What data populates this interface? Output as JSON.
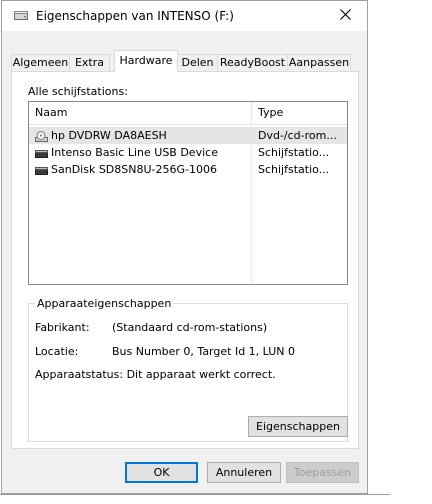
{
  "window": {
    "title": "Eigenschappen van INTENSO (F:)",
    "close_label": "Sluiten"
  },
  "tabs": [
    {
      "label": "Algemeen"
    },
    {
      "label": "Extra"
    },
    {
      "label": "Hardware",
      "active": true
    },
    {
      "label": "Delen"
    },
    {
      "label": "ReadyBoost"
    },
    {
      "label": "Aanpassen"
    }
  ],
  "hardware": {
    "drives_label": "Alle schijfstations:",
    "columns": {
      "name": "Naam",
      "type": "Type"
    },
    "drives": [
      {
        "name": "hp DVDRW  DA8AESH",
        "type": "Dvd-/cd-rom...",
        "icon": "optical-drive-icon",
        "selected": true
      },
      {
        "name": "Intenso Basic Line USB Device",
        "type": "Schijfstatio...",
        "icon": "disk-drive-icon"
      },
      {
        "name": "SanDisk SD8SN8U-256G-1006",
        "type": "Schijfstatio...",
        "icon": "disk-drive-icon"
      }
    ],
    "properties": {
      "group_title": "Apparaateigenschappen",
      "manufacturer_label": "Fabrikant:",
      "manufacturer_value": "(Standaard cd-rom-stations)",
      "location_label": "Locatie:",
      "location_value": "Bus Number 0, Target Id 1, LUN 0",
      "status_label": "Apparaatstatus:",
      "status_value": "Dit apparaat werkt correct.",
      "properties_button": "Eigenschappen"
    }
  },
  "footer": {
    "ok": "OK",
    "cancel": "Annuleren",
    "apply": "Toepassen"
  },
  "colors": {
    "accent": "#0078d7",
    "selection": "#e5e5e5",
    "dialog_bg": "#f0f0f0"
  }
}
